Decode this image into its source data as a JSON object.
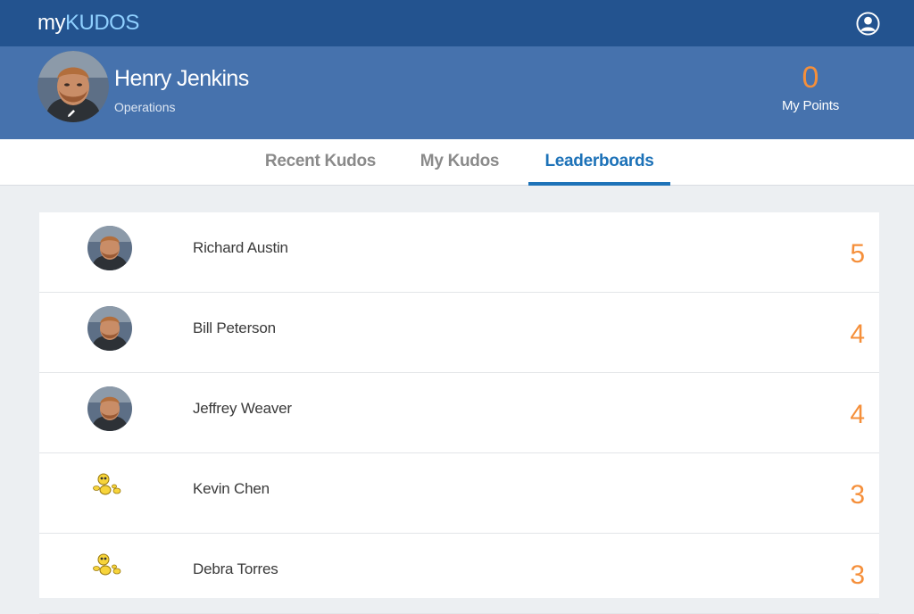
{
  "header": {
    "logo_prefix": "my",
    "logo_accent": "KUDOS",
    "profile_icon": "user-circle-icon"
  },
  "profile": {
    "name": "Henry Jenkins",
    "department": "Operations",
    "points": "0",
    "points_label": "My Points",
    "edit_icon": "pencil-icon"
  },
  "tabs": [
    {
      "label": "Recent Kudos",
      "active": false
    },
    {
      "label": "My Kudos",
      "active": false
    },
    {
      "label": "Leaderboards",
      "active": true
    }
  ],
  "leaderboard": [
    {
      "name": "Richard Austin",
      "points": "5",
      "avatar": "photo-avatar"
    },
    {
      "name": "Bill Peterson",
      "points": "4",
      "avatar": "photo-avatar"
    },
    {
      "name": "Jeffrey Weaver",
      "points": "4",
      "avatar": "photo-avatar"
    },
    {
      "name": "Kevin Chen",
      "points": "3",
      "avatar": "cartoon-avatar"
    },
    {
      "name": "Debra Torres",
      "points": "3",
      "avatar": "cartoon-avatar"
    }
  ],
  "colors": {
    "topbar": "#23538f",
    "profile_band": "#4672ad",
    "accent_blue": "#1d72b8",
    "points_orange": "#f58f3a"
  }
}
